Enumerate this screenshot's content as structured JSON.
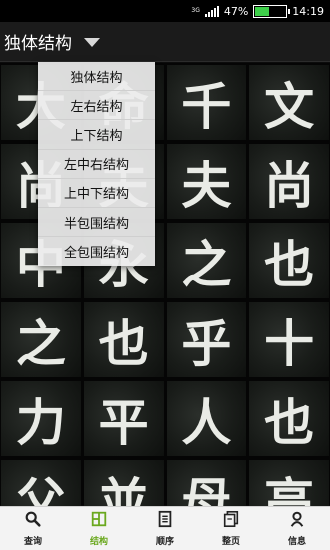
{
  "status_bar": {
    "battery_percent": "47%",
    "battery_level": 0.47,
    "time": "14:19",
    "network_label": "3G",
    "battery_color": "#3ecf4a"
  },
  "title_bar": {
    "title": "独体结构"
  },
  "dropdown": {
    "items": [
      "独体结构",
      "左右结构",
      "上下结构",
      "左中右结构",
      "上中下结构",
      "半包围结构",
      "全包围结构"
    ]
  },
  "grid": {
    "characters": [
      "大",
      "命",
      "千",
      "文",
      "尚",
      "夫",
      "夫",
      "尚",
      "中",
      "永",
      "之",
      "也",
      "之",
      "也",
      "乎",
      "十",
      "力",
      "平",
      "人",
      "也",
      "父",
      "並",
      "母",
      "高"
    ]
  },
  "bottom_nav": {
    "active_color": "#6aa81e",
    "items": [
      {
        "label": "查询",
        "icon": "search-icon"
      },
      {
        "label": "结构",
        "icon": "structure-icon"
      },
      {
        "label": "顺序",
        "icon": "order-icon"
      },
      {
        "label": "整页",
        "icon": "page-icon"
      },
      {
        "label": "信息",
        "icon": "info-icon"
      }
    ]
  }
}
